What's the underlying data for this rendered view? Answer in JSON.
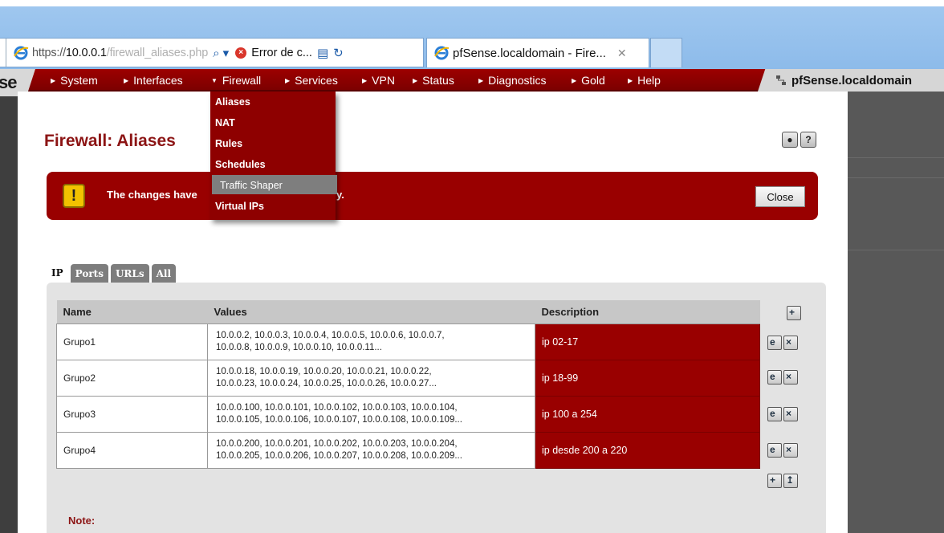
{
  "browser": {
    "url_prefix": "https://",
    "url_host": "10.0.0.1",
    "url_path": "/firewall_aliases.php",
    "search_glyph": "⌕ ▾",
    "error_tab_label": "Error de c...",
    "active_tab_title": "pfSense.localdomain - Fire...",
    "close_tab_glyph": "✕"
  },
  "nav": {
    "logo_text": "se",
    "items": [
      {
        "label": "System"
      },
      {
        "label": "Interfaces"
      },
      {
        "label": "Firewall"
      },
      {
        "label": "Services"
      },
      {
        "label": "VPN"
      },
      {
        "label": "Status"
      },
      {
        "label": "Diagnostics"
      },
      {
        "label": "Gold"
      },
      {
        "label": "Help"
      }
    ],
    "hostname": "pfSense.localdomain"
  },
  "firewall_menu": {
    "items": [
      "Aliases",
      "NAT",
      "Rules",
      "Schedules",
      "Traffic Shaper",
      "Virtual IPs"
    ],
    "highlighted": "Traffic Shaper"
  },
  "page": {
    "title": "Firewall: Aliases",
    "help_glyph": "?"
  },
  "alert": {
    "text": "The changes have",
    "tail": "y.",
    "close_label": "Close"
  },
  "tabs": [
    {
      "label": "IP",
      "active": true
    },
    {
      "label": "Ports",
      "active": false
    },
    {
      "label": "URLs",
      "active": false
    },
    {
      "label": "All",
      "active": false
    }
  ],
  "table": {
    "headers": [
      "Name",
      "Values",
      "Description"
    ],
    "rows": [
      {
        "name": "Grupo1",
        "values_line1": "10.0.0.2, 10.0.0.3, 10.0.0.4, 10.0.0.5, 10.0.0.6, 10.0.0.7,",
        "values_line2": "10.0.0.8, 10.0.0.9, 10.0.0.10, 10.0.0.11...",
        "description": "ip 02-17"
      },
      {
        "name": "Grupo2",
        "values_line1": "10.0.0.18, 10.0.0.19, 10.0.0.20, 10.0.0.21, 10.0.0.22,",
        "values_line2": "10.0.0.23, 10.0.0.24, 10.0.0.25, 10.0.0.26, 10.0.0.27...",
        "description": "ip 18-99"
      },
      {
        "name": "Grupo3",
        "values_line1": "10.0.0.100, 10.0.0.101, 10.0.0.102, 10.0.0.103, 10.0.0.104,",
        "values_line2": "10.0.0.105, 10.0.0.106, 10.0.0.107, 10.0.0.108, 10.0.0.109...",
        "description": "ip 100 a 254"
      },
      {
        "name": "Grupo4",
        "values_line1": "10.0.0.200, 10.0.0.201, 10.0.0.202, 10.0.0.203, 10.0.0.204,",
        "values_line2": "10.0.0.205, 10.0.0.206, 10.0.0.207, 10.0.0.208, 10.0.0.209...",
        "description": "ip desde 200 a 220"
      }
    ]
  },
  "note_label": "Note:",
  "colors": {
    "brand_red": "#990000",
    "title_red": "#8c1414",
    "alert_yellow": "#f2c200"
  },
  "icons": {
    "add": "plus-icon",
    "edit": "edit-icon",
    "delete": "delete-icon",
    "warning": "exclamation-icon",
    "help": "help-icon",
    "log": "log-icon"
  }
}
